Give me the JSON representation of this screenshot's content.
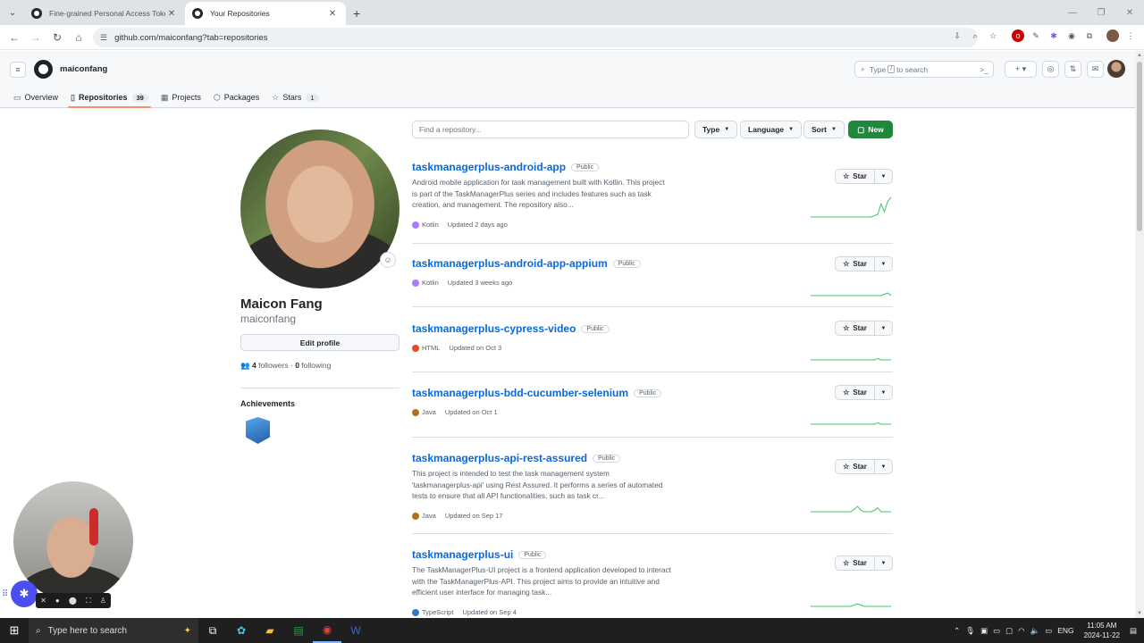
{
  "browser": {
    "tabs": [
      {
        "title": "Fine-grained Personal Access Tokens",
        "active": false
      },
      {
        "title": "Your Repositories",
        "active": true
      }
    ],
    "url": "github.com/maiconfang?tab=repositories"
  },
  "header": {
    "context": "maiconfang",
    "search_text": "Type",
    "search_key": "/",
    "search_suffix": "to search"
  },
  "profile_nav": [
    {
      "label": "Overview",
      "icon": "book-icon",
      "count": null
    },
    {
      "label": "Repositories",
      "icon": "repo-icon",
      "count": "39",
      "selected": true
    },
    {
      "label": "Projects",
      "icon": "table-icon",
      "count": null
    },
    {
      "label": "Packages",
      "icon": "package-icon",
      "count": null
    },
    {
      "label": "Stars",
      "icon": "star-icon",
      "count": "1"
    }
  ],
  "profile": {
    "name": "Maicon Fang",
    "login": "maiconfang",
    "edit_label": "Edit profile",
    "followers_count": "4",
    "followers_label": "followers",
    "following_count": "0",
    "following_label": "following",
    "achievements_title": "Achievements"
  },
  "filters": {
    "placeholder": "Find a repository...",
    "type_label": "Type",
    "language_label": "Language",
    "sort_label": "Sort",
    "new_label": "New"
  },
  "repos": [
    {
      "name": "taskmanagerplus-android-app",
      "visibility": "Public",
      "description": "Android mobile application for task management built with Kotlin. This project is part of the TaskManagerPlus series and includes features such as task creation, and management. The repository also...",
      "language": "Kotlin",
      "lang_color": "#A97BFF",
      "updated": "Updated 2 days ago",
      "activity": [
        0,
        0,
        0,
        0,
        0,
        0,
        0,
        0,
        0,
        0,
        0,
        0,
        0,
        0,
        0,
        0,
        0,
        0,
        0,
        1,
        2,
        10,
        4,
        12,
        15
      ]
    },
    {
      "name": "taskmanagerplus-android-app-appium",
      "visibility": "Public",
      "description": "",
      "language": "Kotlin",
      "lang_color": "#A97BFF",
      "updated": "Updated 3 weeks ago",
      "activity": [
        0,
        0,
        0,
        0,
        0,
        0,
        0,
        0,
        0,
        0,
        0,
        0,
        0,
        0,
        0,
        0,
        0,
        0,
        0,
        0,
        0,
        0,
        1,
        2,
        0
      ]
    },
    {
      "name": "taskmanagerplus-cypress-video",
      "visibility": "Public",
      "description": "",
      "language": "HTML",
      "lang_color": "#e34c26",
      "updated": "Updated on Oct 3",
      "activity": [
        0,
        0,
        0,
        0,
        0,
        0,
        0,
        0,
        0,
        0,
        0,
        0,
        0,
        0,
        0,
        0,
        0,
        0,
        0,
        0,
        1,
        0,
        0,
        0,
        0
      ]
    },
    {
      "name": "taskmanagerplus-bdd-cucumber-selenium",
      "visibility": "Public",
      "description": "",
      "language": "Java",
      "lang_color": "#b07219",
      "updated": "Updated on Oct 1",
      "activity": [
        0,
        0,
        0,
        0,
        0,
        0,
        0,
        0,
        0,
        0,
        0,
        0,
        0,
        0,
        0,
        0,
        0,
        0,
        0,
        0,
        1,
        0,
        0,
        0,
        0
      ]
    },
    {
      "name": "taskmanagerplus-api-rest-assured",
      "visibility": "Public",
      "description": "This project is intended to test the task management system 'taskmanagerplus-api' using Rest Assured. It performs a series of automated tests to ensure that all API functionalities, such as task cr...",
      "language": "Java",
      "lang_color": "#b07219",
      "updated": "Updated on Sep 17",
      "activity": [
        0,
        0,
        0,
        0,
        0,
        0,
        0,
        0,
        0,
        0,
        0,
        0,
        0,
        2,
        4,
        1,
        0,
        0,
        0,
        1,
        3,
        0,
        0,
        0,
        0
      ]
    },
    {
      "name": "taskmanagerplus-ui",
      "visibility": "Public",
      "description": "The TaskManagerPlus-UI project is a frontend application developed to interact with the TaskManagerPlus-API. This project aims to provide an intuitive and efficient user interface for managing task...",
      "language": "TypeScript",
      "lang_color": "#3178c6",
      "updated": "Updated on Sep 4",
      "activity": [
        0,
        0,
        0,
        0,
        0,
        0,
        0,
        0,
        0,
        0,
        0,
        0,
        0,
        1,
        2,
        1,
        0,
        0,
        0,
        0,
        0,
        0,
        0,
        0,
        0
      ]
    }
  ],
  "star_label": "Star",
  "taskbar": {
    "search_placeholder": "Type here to search",
    "lang": "ENG",
    "time": "11:05 AM",
    "date": "2024-11-22"
  }
}
